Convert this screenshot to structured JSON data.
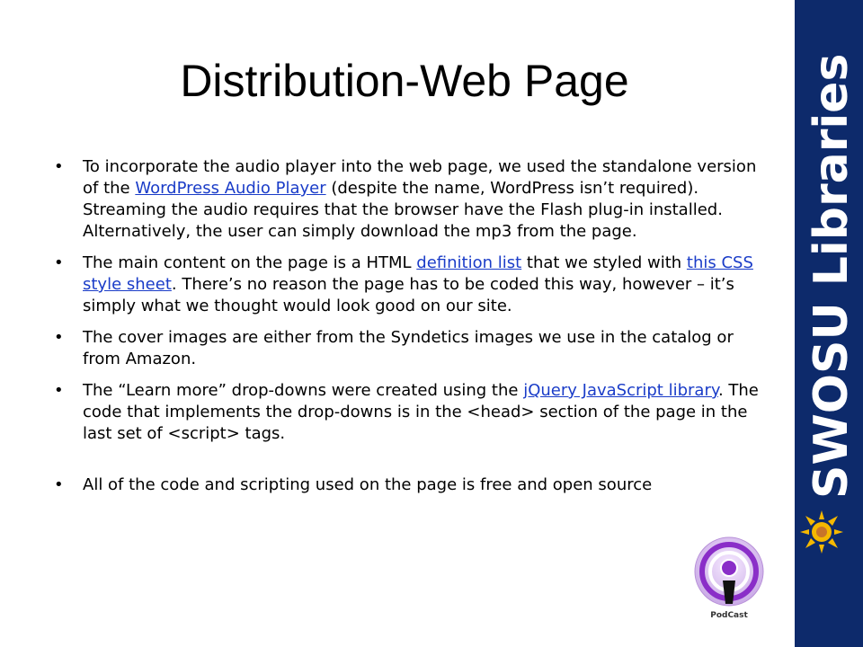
{
  "title": "Distribution-Web Page",
  "bullets": [
    {
      "parts": [
        {
          "t": "To incorporate the audio player into the web page, we used the standalone version of the "
        },
        {
          "t": "WordPress Audio Player",
          "link": true
        },
        {
          "t": " (despite the name, WordPress isn’t required). Streaming the audio requires that the browser have the Flash plug-in installed. Alternatively, the user can simply download the mp3 from the page."
        }
      ]
    },
    {
      "parts": [
        {
          "t": "The main content on the page is a HTML "
        },
        {
          "t": "definition list",
          "link": true
        },
        {
          "t": " that we styled with "
        },
        {
          "t": "this CSS style sheet",
          "link": true
        },
        {
          "t": ". There’s no reason the page has to be coded this way, however – it’s simply what we thought would look good on our site."
        }
      ]
    },
    {
      "parts": [
        {
          "t": "The cover images are either from the Syndetics images we use in the catalog or from Amazon."
        }
      ]
    },
    {
      "parts": [
        {
          "t": "The “Learn more” drop-downs were created using the "
        },
        {
          "t": "jQuery JavaScript library",
          "link": true
        },
        {
          "t": ". The code that implements the drop-downs is in the <head> section of the page in the last set of <script> tags."
        }
      ]
    },
    {
      "gap": true,
      "parts": [
        {
          "t": "All of the code and scripting used on the page is free and open source"
        }
      ]
    }
  ],
  "sidebar": {
    "logo_text": "SWOSU Libraries",
    "bg_color": "#0d2a6b",
    "sun_color": "#f5b800"
  },
  "podcast": {
    "label": "PodCast",
    "icon": "podcast-icon",
    "color": "#8a2ec8"
  },
  "colors": {
    "link": "#1a3cc8"
  }
}
